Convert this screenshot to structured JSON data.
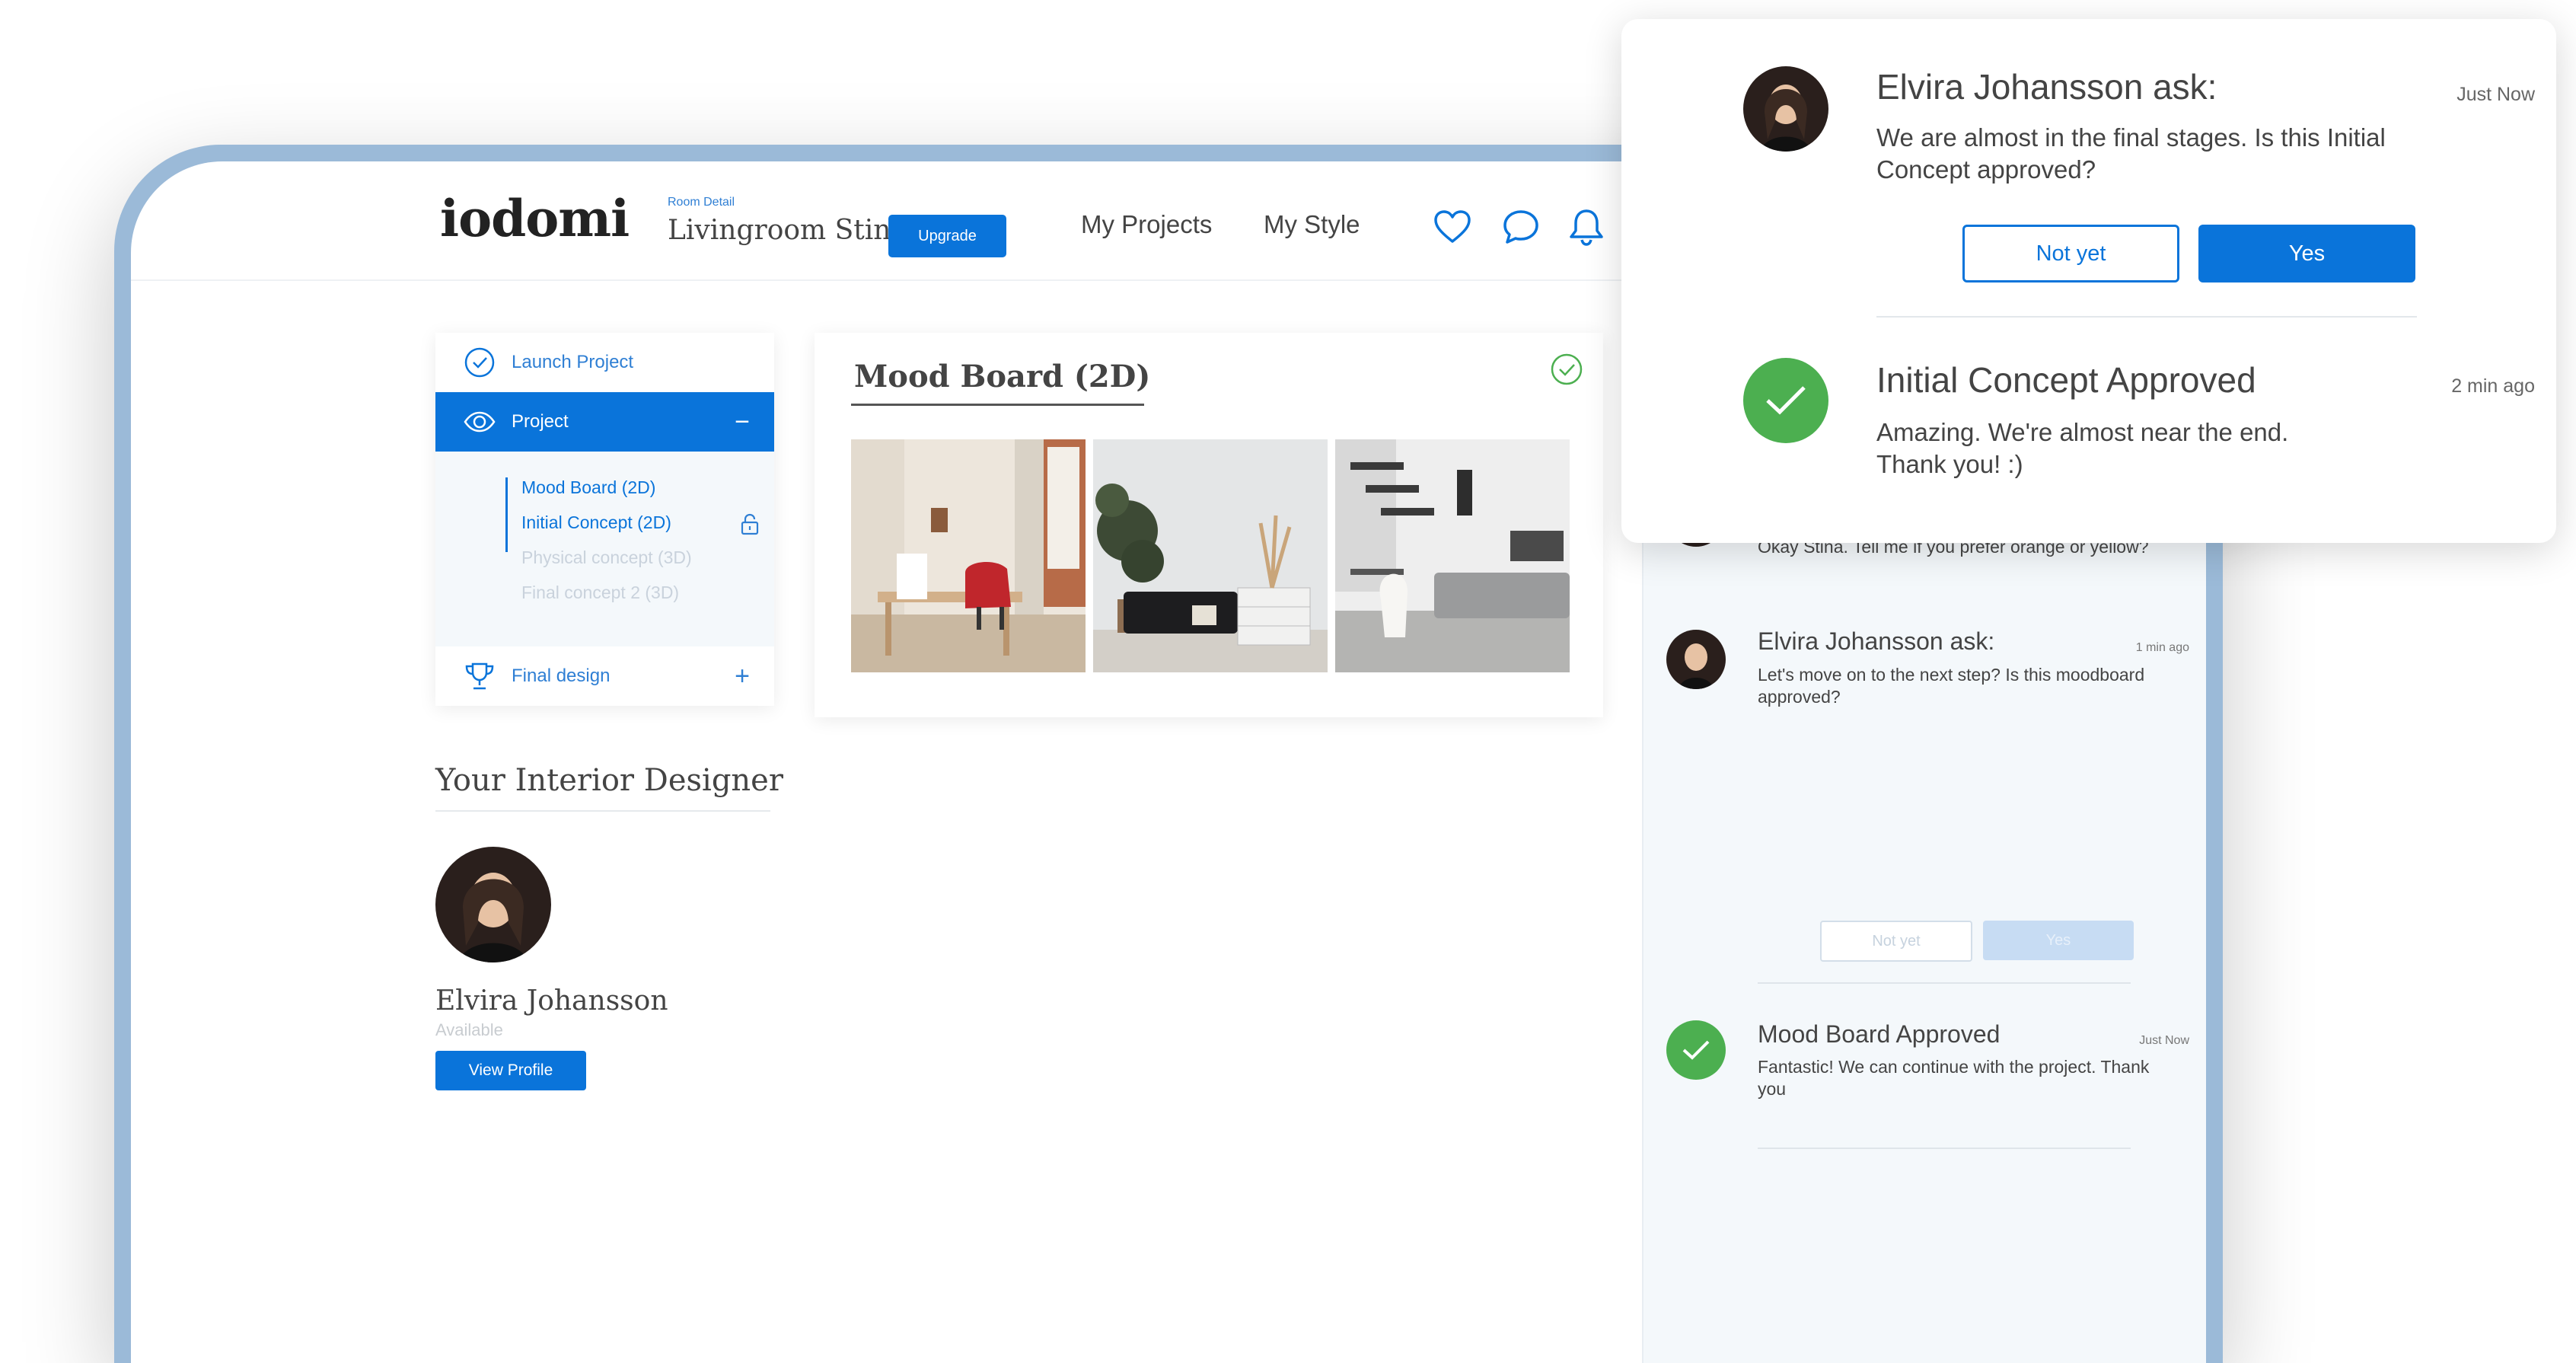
{
  "colors": {
    "accent": "#0a74da",
    "success": "#4caf50",
    "frame": "#9bbad8",
    "panel_bg": "#f4f8fb"
  },
  "header": {
    "logo": "iodomi",
    "room_label": "Room Detail",
    "room_name": "Livingroom Stina",
    "upgrade_label": "Upgrade",
    "nav": [
      "My  Projects",
      "My  Style"
    ],
    "icons": [
      "heart-icon",
      "chat-bubble-icon",
      "bell-icon"
    ]
  },
  "project_panel": {
    "launch": "Launch Project",
    "project": "Project",
    "project_toggle": "−",
    "subitems": [
      {
        "label": "Mood Board (2D)",
        "state": "active"
      },
      {
        "label": "Initial Concept (2D)",
        "state": "active",
        "icon": "lock-icon"
      },
      {
        "label": "Physical concept (3D)",
        "state": "disabled"
      },
      {
        "label": "Final concept 2 (3D)",
        "state": "disabled"
      }
    ],
    "final": "Final design",
    "final_toggle": "+"
  },
  "mood_board": {
    "title": "Mood Board (2D)",
    "status_icon": "check-circle-icon"
  },
  "designer": {
    "section_title": "Your Interior Designer",
    "name": "Elvira Johansson",
    "status": "Available",
    "view_profile": "View Profile"
  },
  "chat": {
    "messages": [
      {
        "body": "Okay Stina. Tell me if you prefer orange or yellow?"
      },
      {
        "title": "Elvira Johansson ask:",
        "time": "1 min ago",
        "body": "Let's move on to the next step? Is this moodboard approved?",
        "btn_no": "Not yet",
        "btn_yes": "Yes"
      },
      {
        "title": "Mood Board Approved",
        "time": "Just Now",
        "body": "Fantastic! We can continue with the project. Thank you"
      }
    ]
  },
  "popup": {
    "first": {
      "title": "Elvira Johansson ask:",
      "time": "Just Now",
      "body": "We are almost in the final stages. Is this Initial Concept approved?",
      "btn_no": "Not yet",
      "btn_yes": "Yes"
    },
    "second": {
      "title": "Initial Concept Approved",
      "time": "2 min ago",
      "body": "Amazing. We're almost near the end. Thank you! :)"
    }
  }
}
